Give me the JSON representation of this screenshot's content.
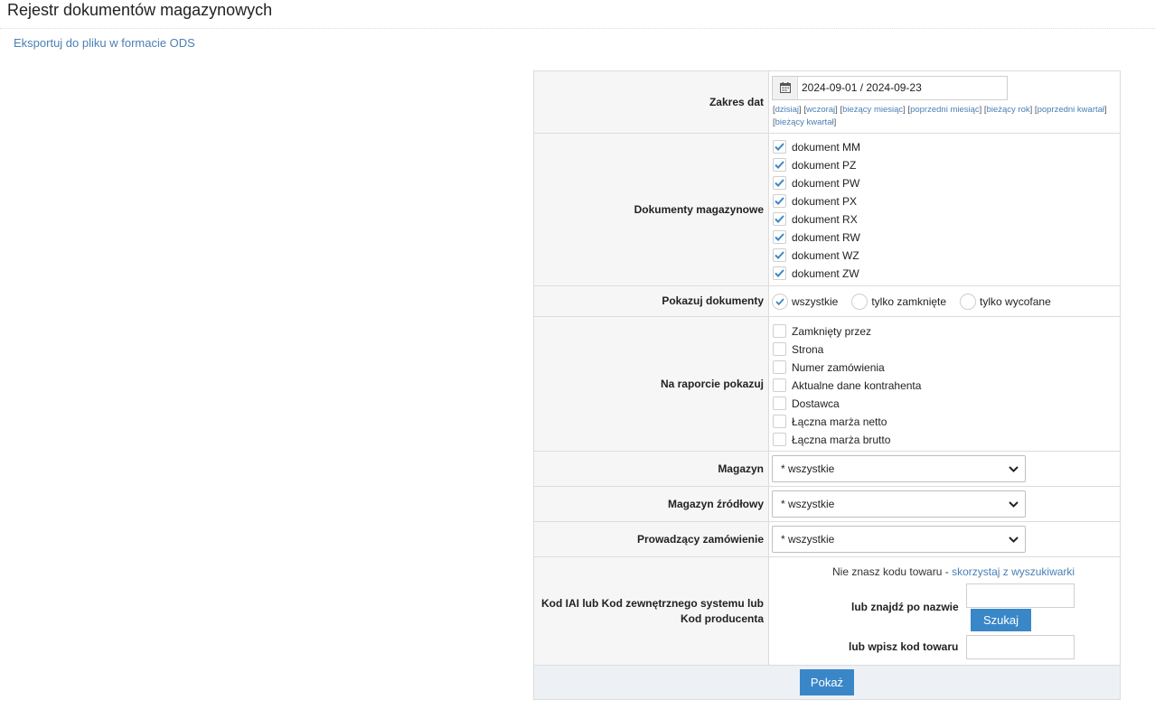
{
  "page": {
    "title": "Rejestr dokumentów magazynowych",
    "export_link": "Eksportuj do pliku w formacie ODS"
  },
  "date_range": {
    "label": "Zakres dat",
    "value": "2024-09-01 / 2024-09-23",
    "icon": "calendar-icon",
    "quick_links": [
      "dzisiaj",
      "wczoraj",
      "bieżący miesiąc",
      "poprzedni miesiąc",
      "bieżący rok",
      "poprzedni kwartał",
      "bieżący kwartał"
    ]
  },
  "documents": {
    "label": "Dokumenty magazynowe",
    "items": [
      {
        "label": "dokument MM",
        "checked": true
      },
      {
        "label": "dokument PZ",
        "checked": true
      },
      {
        "label": "dokument PW",
        "checked": true
      },
      {
        "label": "dokument PX",
        "checked": true
      },
      {
        "label": "dokument RX",
        "checked": true
      },
      {
        "label": "dokument RW",
        "checked": true
      },
      {
        "label": "dokument WZ",
        "checked": true
      },
      {
        "label": "dokument ZW",
        "checked": true
      }
    ]
  },
  "show_documents": {
    "label": "Pokazuj dokumenty",
    "options": [
      {
        "label": "wszystkie",
        "selected": true
      },
      {
        "label": "tylko zamknięte",
        "selected": false
      },
      {
        "label": "tylko wycofane",
        "selected": false
      }
    ]
  },
  "report_columns": {
    "label": "Na raporcie pokazuj",
    "items": [
      {
        "label": "Zamknięty przez",
        "checked": false
      },
      {
        "label": "Strona",
        "checked": false
      },
      {
        "label": "Numer zamówienia",
        "checked": false
      },
      {
        "label": "Aktualne dane kontrahenta",
        "checked": false
      },
      {
        "label": "Dostawca",
        "checked": false
      },
      {
        "label": "Łączna marża netto",
        "checked": false
      },
      {
        "label": "Łączna marża brutto",
        "checked": false
      }
    ]
  },
  "warehouse": {
    "label": "Magazyn",
    "value": "* wszystkie"
  },
  "source_warehouse": {
    "label": "Magazyn źródłowy",
    "value": "* wszystkie"
  },
  "order_handler": {
    "label": "Prowadzący zamówienie",
    "value": "* wszystkie"
  },
  "product_code": {
    "label": "Kod IAI lub Kod zewnętrznego systemu lub Kod producenta",
    "hint_text": "Nie znasz kodu towaru - ",
    "hint_link": "skorzystaj z wyszukiwarki",
    "by_name_label": "lub znajdź po nazwie",
    "search_button": "Szukaj",
    "by_code_label": "lub wpisz kod towaru",
    "name_value": "",
    "code_value": ""
  },
  "submit_button": "Pokaż",
  "colors": {
    "link": "#4a7fb5",
    "button": "#3a87c8",
    "check": "#3a87c8"
  }
}
